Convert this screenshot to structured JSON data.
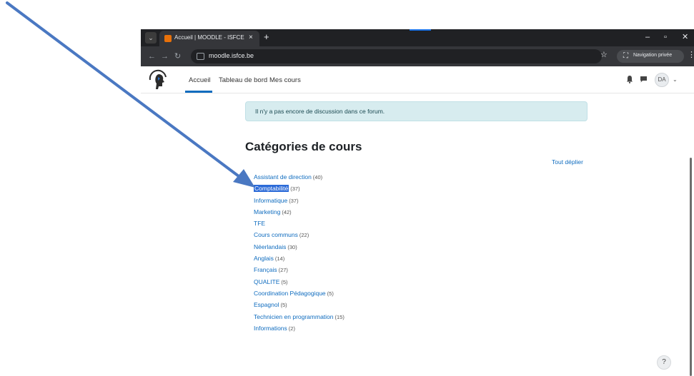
{
  "browser": {
    "tab_title": "Accueil | MOODLE - ISFCE",
    "tab_close": "×",
    "new_tab": "+",
    "url": "moodle.isfce.be",
    "private_label": "Navigation privée",
    "icons": [
      "tab-menu-icon",
      "back-icon",
      "forward-icon",
      "reload-icon",
      "site-info-icon",
      "star-icon",
      "incognito-icon",
      "kebab-icon"
    ]
  },
  "moodle_nav": {
    "links": [
      "Accueil",
      "Tableau de bord",
      "Mes cours"
    ],
    "active": "Accueil",
    "avatar_initials": "DA",
    "accent_color": "#0f6cbf"
  },
  "alert": {
    "text": "Il n'y a pas encore de discussion dans ce forum."
  },
  "categories": {
    "heading": "Catégories de cours",
    "expand_all": "Tout déplier",
    "items": [
      {
        "name": "Assistant de direction",
        "count": "(40)"
      },
      {
        "name": "Comptabilité",
        "count": "(37)"
      },
      {
        "name": "Informatique",
        "count": "(37)"
      },
      {
        "name": "Marketing",
        "count": "(42)"
      },
      {
        "name": "TFE",
        "count": ""
      },
      {
        "name": "Cours communs",
        "count": "(22)"
      },
      {
        "name": "Néerlandais",
        "count": "(30)"
      },
      {
        "name": "Anglais",
        "count": "(14)"
      },
      {
        "name": "Français",
        "count": "(27)"
      },
      {
        "name": "QUALITE",
        "count": "(5)"
      },
      {
        "name": "Coordination Pédagogique",
        "count": "(5)"
      },
      {
        "name": "Espagnol",
        "count": "(5)"
      },
      {
        "name": "Technicien en programmation",
        "count": "(15)"
      },
      {
        "name": "Informations",
        "count": "(2)"
      }
    ],
    "selected": "Comptabilité"
  },
  "help": {
    "label": "?"
  },
  "annotation": {
    "arrow_color": "#4a78c2"
  }
}
